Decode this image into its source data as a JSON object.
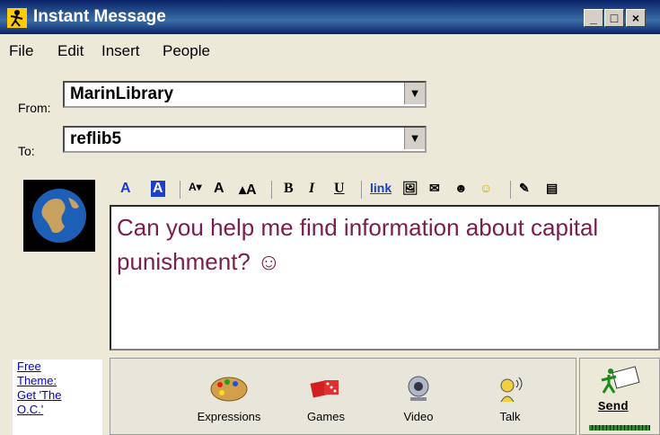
{
  "window": {
    "title": "Instant Message"
  },
  "menu": [
    "File",
    "Edit",
    "Insert",
    "People"
  ],
  "from": {
    "label": "From:",
    "value": "MarinLibrary"
  },
  "to": {
    "label": "To:",
    "value": "reflib5"
  },
  "toolbar": {
    "link_label": "link",
    "bold": "B",
    "italic": "I",
    "underline": "U"
  },
  "message": {
    "text": "Can you help me find information about capital punishment? ☺"
  },
  "ad": {
    "lines": [
      "Free",
      "Theme:",
      "Get 'The",
      "O.C.'"
    ]
  },
  "actions": [
    {
      "label": "Expressions",
      "icon": "palette-icon"
    },
    {
      "label": "Games",
      "icon": "dice-icon"
    },
    {
      "label": "Video",
      "icon": "webcam-icon"
    },
    {
      "label": "Talk",
      "icon": "headset-icon"
    }
  ],
  "send": {
    "label": "Send"
  }
}
